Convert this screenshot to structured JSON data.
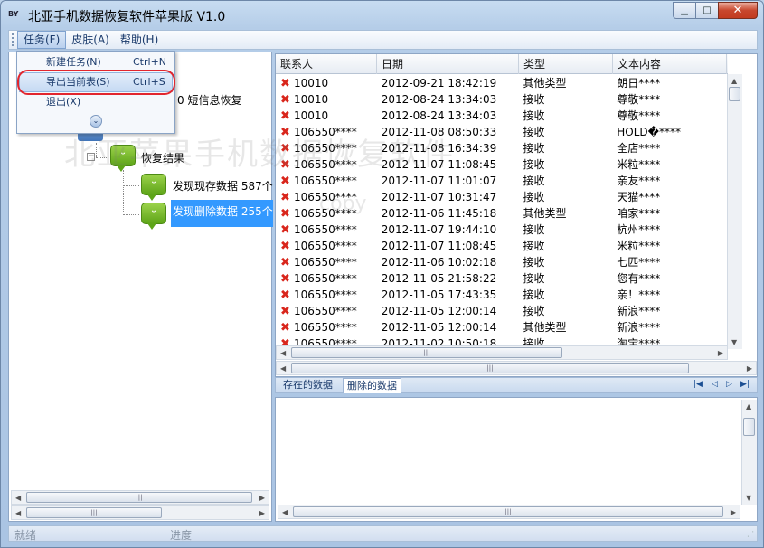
{
  "window": {
    "title": "北亚手机数据恢复软件苹果版 V1.0",
    "app_icon_text": "BY"
  },
  "menubar": {
    "items": [
      {
        "label": "任务(F)"
      },
      {
        "label": "皮肤(A)"
      },
      {
        "label": "帮助(H)"
      }
    ]
  },
  "dropdown": {
    "items": [
      {
        "label": "新建任务(N)",
        "shortcut": "Ctrl+N"
      },
      {
        "label": "导出当前表(S)",
        "shortcut": "Ctrl+S"
      },
      {
        "label": "退出(X)",
        "shortcut": ""
      }
    ],
    "more_glyph": "⌄"
  },
  "tree": {
    "root_partial": "0 短信息恢复",
    "results": "恢复结果",
    "existing": "发现现存数据 587个",
    "deleted": "发现删除数据 255个"
  },
  "grid": {
    "columns": [
      "联系人",
      "日期",
      "类型",
      "文本内容"
    ],
    "rows": [
      [
        "10010",
        "2012-09-21  18:42:19",
        "其他类型",
        "朗日****"
      ],
      [
        "10010",
        "2012-08-24  13:34:03",
        "接收",
        "尊敬****"
      ],
      [
        "10010",
        "2012-08-24  13:34:03",
        "接收",
        "尊敬****"
      ],
      [
        "106550****",
        "2012-11-08  08:50:33",
        "接收",
        "HOLD�****"
      ],
      [
        "106550****",
        "2012-11-08  16:34:39",
        "接收",
        "全店****"
      ],
      [
        "106550****",
        "2012-11-07  11:08:45",
        "接收",
        "米粒****"
      ],
      [
        "106550****",
        "2012-11-07  11:01:07",
        "接收",
        "亲友****"
      ],
      [
        "106550****",
        "2012-11-07  10:31:47",
        "接收",
        "天猫****"
      ],
      [
        "106550****",
        "2012-11-06  11:45:18",
        "其他类型",
        "咱家****"
      ],
      [
        "106550****",
        "2012-11-07  19:44:10",
        "接收",
        "杭州****"
      ],
      [
        "106550****",
        "2012-11-07  11:08:45",
        "接收",
        "米粒****"
      ],
      [
        "106550****",
        "2012-11-06  10:02:18",
        "接收",
        "七匹****"
      ],
      [
        "106550****",
        "2012-11-05  21:58:22",
        "接收",
        "您有****"
      ],
      [
        "106550****",
        "2012-11-05  17:43:35",
        "接收",
        "亲！****"
      ],
      [
        "106550****",
        "2012-11-05  12:00:14",
        "接收",
        "新浪****"
      ],
      [
        "106550****",
        "2012-11-05  12:00:14",
        "其他类型",
        "新浪****"
      ],
      [
        "106550****",
        "2012-11-02  10:50:18",
        "接收",
        "淘宝****"
      ]
    ]
  },
  "tabs": {
    "existing": "存在的数据",
    "deleted": "删除的数据"
  },
  "watermark": {
    "line1": "北亚苹果手机数据恢复软件",
    "line2": "copy"
  },
  "statusbar": {
    "ready": "就绪",
    "progress": "进度"
  }
}
